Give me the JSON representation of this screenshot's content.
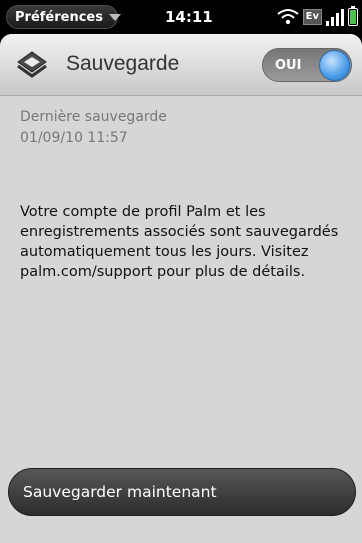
{
  "status_bar": {
    "app_menu_label": "Préférences",
    "time": "14:11",
    "network_label": "Ev",
    "signal_bars": 4,
    "battery_level": 1.0,
    "battery_color": "#4cc14c"
  },
  "header": {
    "title": "Sauvegarde",
    "toggle_label": "OUI",
    "toggle_on": true
  },
  "content": {
    "last_backup_label": "Dernière sauvegarde",
    "last_backup_date": "01/09/10 11:57",
    "description": "Votre compte de profil Palm et les enregistrements associés sont sauvegardés automatiquement tous les jours. Visitez palm.com/support pour plus de détails."
  },
  "actions": {
    "backup_now_label": "Sauvegarder maintenant"
  },
  "colors": {
    "accent": "#4a9be8"
  }
}
